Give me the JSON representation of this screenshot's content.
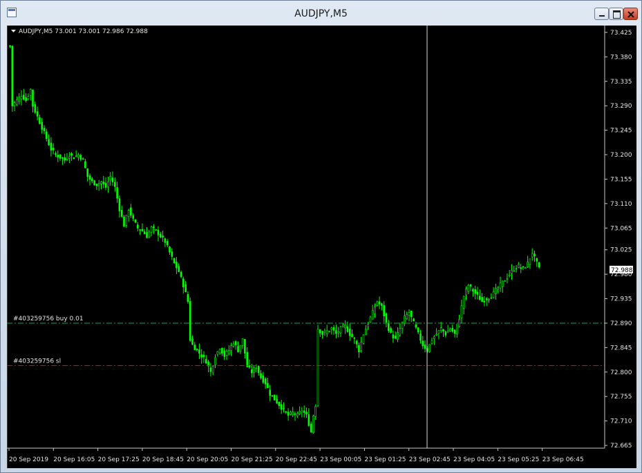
{
  "window": {
    "title": "AUDJPY,M5"
  },
  "header": {
    "symbol_info": "AUDJPY,M5  73.001 73.001 72.986 72.988"
  },
  "price_tag": "72.988",
  "colors": {
    "bull": "#00ff00",
    "bear": "#00ff00",
    "buy_line": "#00b050",
    "sl_line": "#e01010",
    "crosshair": "#d8d8d8",
    "text": "#e6e6e6"
  },
  "chart_data": {
    "type": "candlestick",
    "y_range": [
      72.66,
      73.43
    ],
    "y_ticks": [
      "73.425",
      "73.380",
      "73.335",
      "73.290",
      "73.245",
      "73.200",
      "73.155",
      "73.110",
      "73.065",
      "73.025",
      "72.980",
      "72.935",
      "72.890",
      "72.845",
      "72.800",
      "72.755",
      "72.710",
      "72.665"
    ],
    "x_ticks": [
      "20 Sep 2019",
      "20 Sep 16:05",
      "20 Sep 17:25",
      "20 Sep 18:45",
      "20 Sep 20:05",
      "20 Sep 21:25",
      "20 Sep 22:45",
      "23 Sep 00:05",
      "23 Sep 01:25",
      "23 Sep 02:45",
      "23 Sep 04:05",
      "23 Sep 05:25",
      "23 Sep 06:45"
    ],
    "last_price": 72.988,
    "trade_lines": [
      {
        "label": "#403259756 buy 0.01",
        "price": 72.89
      },
      {
        "label": "#403259756 sl",
        "price": 72.812
      }
    ],
    "crosshair_time": "23 Sep 02:45",
    "close_path": [
      [
        0,
        73.4
      ],
      [
        1,
        73.29
      ],
      [
        3,
        73.3
      ],
      [
        5,
        73.31
      ],
      [
        7,
        73.3
      ],
      [
        9,
        73.32
      ],
      [
        10,
        73.29
      ],
      [
        12,
        73.27
      ],
      [
        14,
        73.25
      ],
      [
        16,
        73.23
      ],
      [
        18,
        73.21
      ],
      [
        20,
        73.2
      ],
      [
        22,
        73.195
      ],
      [
        24,
        73.19
      ],
      [
        26,
        73.2
      ],
      [
        28,
        73.195
      ],
      [
        30,
        73.2
      ],
      [
        32,
        73.19
      ],
      [
        34,
        73.16
      ],
      [
        36,
        73.15
      ],
      [
        38,
        73.145
      ],
      [
        40,
        73.15
      ],
      [
        42,
        73.14
      ],
      [
        44,
        73.16
      ],
      [
        46,
        73.14
      ],
      [
        48,
        73.1
      ],
      [
        50,
        73.07
      ],
      [
        52,
        73.1
      ],
      [
        54,
        73.08
      ],
      [
        56,
        73.065
      ],
      [
        58,
        73.06
      ],
      [
        60,
        73.05
      ],
      [
        62,
        73.065
      ],
      [
        64,
        73.06
      ],
      [
        66,
        73.05
      ],
      [
        68,
        73.04
      ],
      [
        70,
        73.02
      ],
      [
        72,
        73.0
      ],
      [
        74,
        72.985
      ],
      [
        76,
        72.96
      ],
      [
        78,
        72.93
      ],
      [
        79,
        72.86
      ],
      [
        80,
        72.85
      ],
      [
        82,
        72.84
      ],
      [
        84,
        72.83
      ],
      [
        86,
        72.82
      ],
      [
        88,
        72.8
      ],
      [
        90,
        72.83
      ],
      [
        92,
        72.845
      ],
      [
        94,
        72.83
      ],
      [
        96,
        72.84
      ],
      [
        98,
        72.855
      ],
      [
        100,
        72.84
      ],
      [
        102,
        72.86
      ],
      [
        104,
        72.81
      ],
      [
        106,
        72.8
      ],
      [
        108,
        72.81
      ],
      [
        110,
        72.79
      ],
      [
        112,
        72.78
      ],
      [
        114,
        72.76
      ],
      [
        116,
        72.75
      ],
      [
        118,
        72.74
      ],
      [
        120,
        72.73
      ],
      [
        122,
        72.72
      ],
      [
        124,
        72.725
      ],
      [
        126,
        72.72
      ],
      [
        128,
        72.73
      ],
      [
        130,
        72.72
      ],
      [
        132,
        72.69
      ],
      [
        133,
        72.72
      ],
      [
        134,
        72.74
      ],
      [
        135,
        72.88
      ],
      [
        137,
        72.87
      ],
      [
        139,
        72.875
      ],
      [
        141,
        72.88
      ],
      [
        143,
        72.87
      ],
      [
        145,
        72.88
      ],
      [
        147,
        72.885
      ],
      [
        149,
        72.87
      ],
      [
        151,
        72.86
      ],
      [
        153,
        72.84
      ],
      [
        155,
        72.87
      ],
      [
        157,
        72.89
      ],
      [
        159,
        72.91
      ],
      [
        161,
        72.93
      ],
      [
        163,
        72.92
      ],
      [
        165,
        72.89
      ],
      [
        167,
        72.87
      ],
      [
        169,
        72.86
      ],
      [
        171,
        72.88
      ],
      [
        173,
        72.9
      ],
      [
        175,
        72.91
      ],
      [
        177,
        72.89
      ],
      [
        179,
        72.87
      ],
      [
        181,
        72.85
      ],
      [
        183,
        72.84
      ],
      [
        185,
        72.86
      ],
      [
        187,
        72.87
      ],
      [
        189,
        72.88
      ],
      [
        191,
        72.87
      ],
      [
        193,
        72.88
      ],
      [
        195,
        72.87
      ],
      [
        197,
        72.9
      ],
      [
        199,
        72.94
      ],
      [
        201,
        72.96
      ],
      [
        203,
        72.95
      ],
      [
        205,
        72.94
      ],
      [
        207,
        72.93
      ],
      [
        209,
        72.935
      ],
      [
        211,
        72.94
      ],
      [
        213,
        72.95
      ],
      [
        215,
        72.96
      ],
      [
        217,
        72.97
      ],
      [
        219,
        72.98
      ],
      [
        221,
        72.99
      ],
      [
        223,
        72.995
      ],
      [
        225,
        72.99
      ],
      [
        227,
        73.0
      ],
      [
        229,
        73.02
      ],
      [
        230,
        73.01
      ],
      [
        232,
        72.99
      ]
    ]
  }
}
